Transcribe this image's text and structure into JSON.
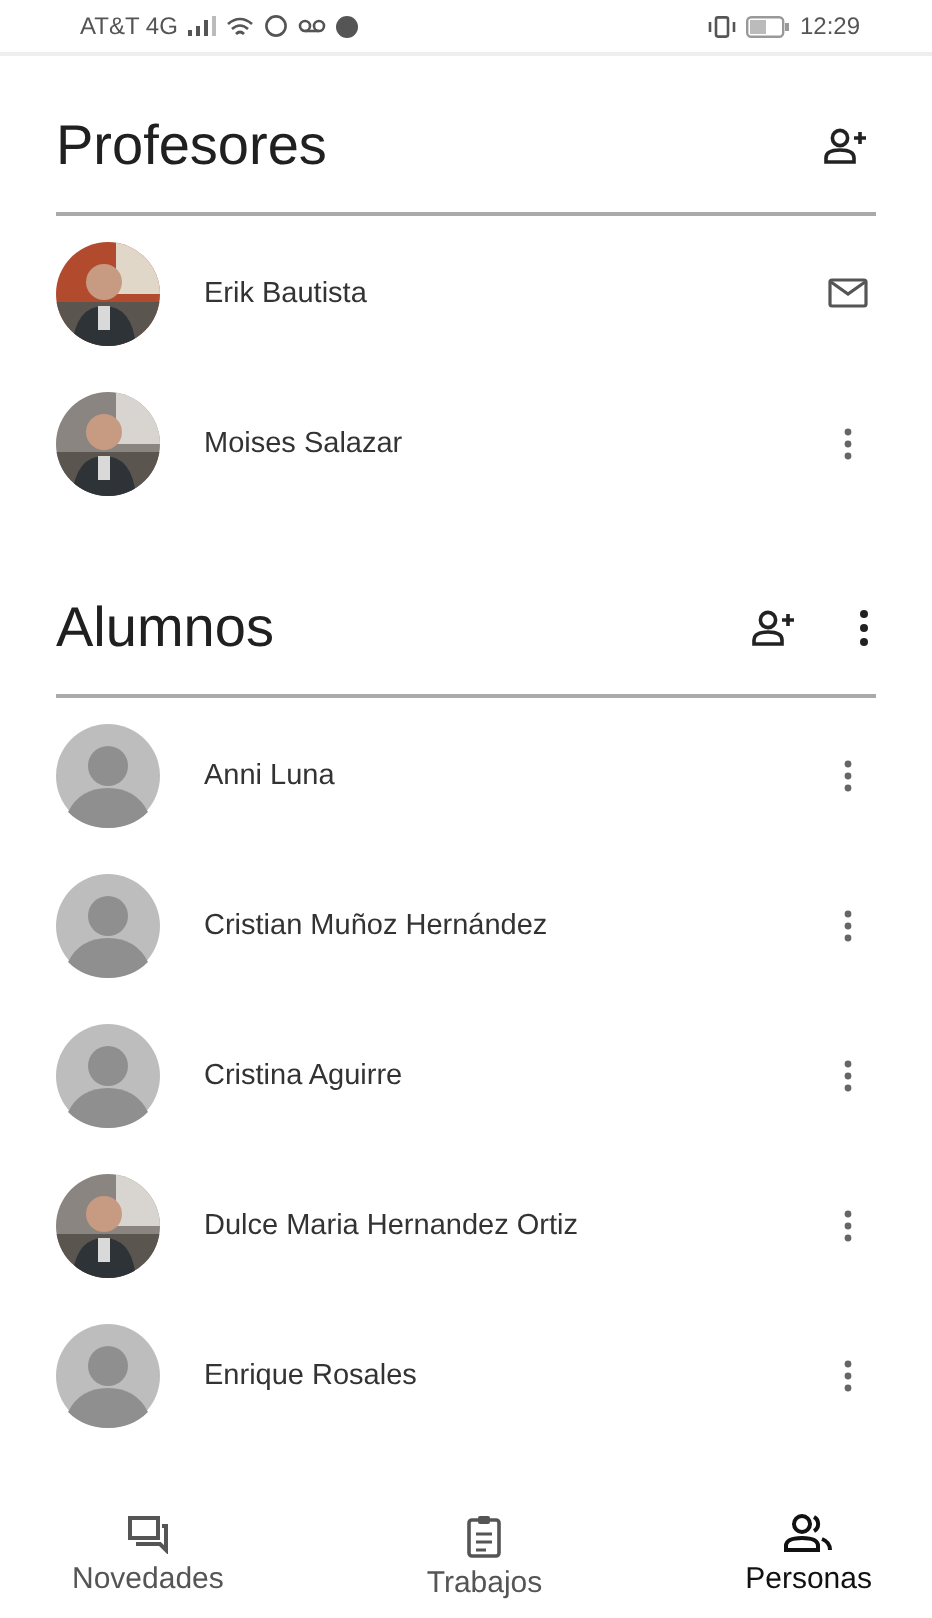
{
  "status_bar": {
    "carrier": "AT&T 4G",
    "time": "12:29"
  },
  "sections": [
    {
      "title": "Profesores",
      "actions": [
        {
          "kind": "add"
        }
      ],
      "people": [
        {
          "name": "Erik Bautista",
          "action": {
            "kind": "email"
          }
        },
        {
          "name": "Moises Salazar",
          "action": {
            "kind": "more"
          }
        }
      ]
    },
    {
      "title": "Alumnos",
      "actions": [
        {
          "kind": "add"
        },
        {
          "kind": "more"
        }
      ],
      "people": [
        {
          "name": "Anni Luna",
          "avatar": {
            "kind": "placeholder"
          },
          "action": {
            "kind": "more"
          }
        },
        {
          "name": "Cristian Muñoz Hernández",
          "avatar": {
            "kind": "placeholder"
          },
          "action": {
            "kind": "more"
          }
        },
        {
          "name": "Cristina Aguirre",
          "avatar": {
            "kind": "placeholder"
          },
          "action": {
            "kind": "more"
          }
        },
        {
          "name": "Dulce Maria Hernandez Ortiz",
          "action": {
            "kind": "more"
          }
        },
        {
          "name": "Enrique Rosales",
          "avatar": {
            "kind": "placeholder"
          },
          "action": {
            "kind": "more"
          }
        }
      ]
    }
  ],
  "nav": [
    {
      "label": "Novedades",
      "kind": "stream",
      "selected": false
    },
    {
      "label": "Trabajos",
      "kind": "classwork",
      "selected": false
    },
    {
      "label": "Personas",
      "kind": "people",
      "selected": true
    }
  ]
}
